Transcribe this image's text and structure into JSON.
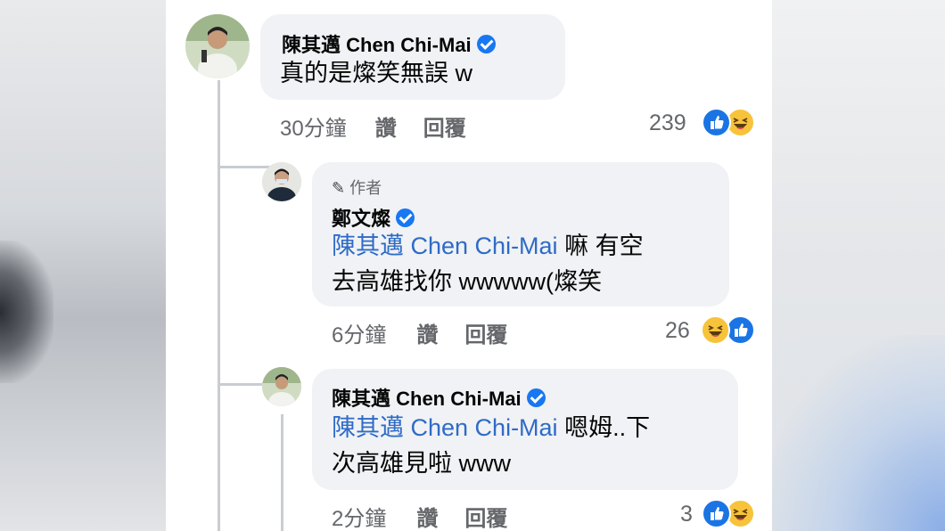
{
  "comments": [
    {
      "name": "陳其邁 Chen Chi-Mai",
      "text": "真的是燦笑無誤 w",
      "time": "30分鐘",
      "like": "讚",
      "reply": "回覆",
      "count": "239",
      "reactions": [
        "like-icon",
        "haha-icon"
      ]
    },
    {
      "author_badge": "作者",
      "name": "鄭文燦",
      "mention": "陳其邁 Chen Chi-Mai",
      "text1_rest": " 嘛 有空",
      "text2": "去高雄找你 wwwww(燦笑",
      "time": "6分鐘",
      "like": "讚",
      "reply": "回覆",
      "count": "26",
      "reactions": [
        "haha-icon",
        "like-icon"
      ]
    },
    {
      "name": "陳其邁 Chen Chi-Mai",
      "mention": "陳其邁 Chen Chi-Mai",
      "text1_rest": " 嗯姆..下",
      "text2": "次高雄見啦 www",
      "time": "2分鐘",
      "like": "讚",
      "reply": "回覆",
      "count": "3",
      "reactions": [
        "like-icon",
        "haha-icon"
      ]
    }
  ],
  "colors": {
    "bubble": "#f0f2f5",
    "mention": "#2e6bc7",
    "meta": "#65676b",
    "verified": "#1877f2"
  }
}
